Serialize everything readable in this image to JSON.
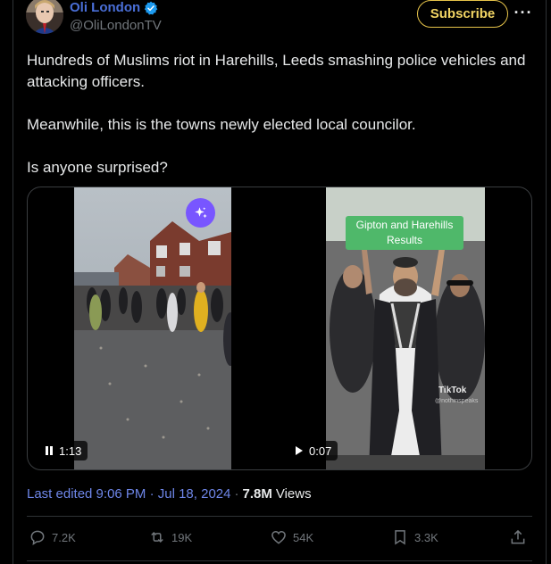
{
  "author": {
    "display_name": "Oli London",
    "handle": "@OliLondonTV",
    "avatar": "avatar",
    "verified": true
  },
  "header": {
    "subscribe_label": "Subscribe",
    "more_icon": "more-icon"
  },
  "tweet": {
    "lines": [
      "Hundreds of Muslims riot in Harehills, Leeds smashing police vehicles and attacking officers.",
      "Meanwhile, this is the towns newly elected local councilor.",
      "Is anyone surprised?"
    ]
  },
  "media": {
    "left_video": {
      "duration": "1:13",
      "state_icon": "pause-icon",
      "badge_icon": "sparkle-icon"
    },
    "right_video": {
      "duration": "0:07",
      "state_icon": "play-icon",
      "caption": "Gipton and Harehills Results",
      "watermark": "TikTok",
      "watermark_handle": "@nothinspeaks"
    }
  },
  "meta": {
    "edited": "Last edited 9:06 PM · Jul 18, 2024",
    "separator": "·",
    "views_count": "7.8M",
    "views_label": "Views"
  },
  "actions": {
    "replies": "7.2K",
    "reposts": "19K",
    "likes": "54K",
    "bookmarks": "3.3K"
  },
  "colors": {
    "accent": "#4a6fd8",
    "subscribe_border": "#e8c54a",
    "sparkle_badge": "#7856ff",
    "muted": "#71767b"
  }
}
